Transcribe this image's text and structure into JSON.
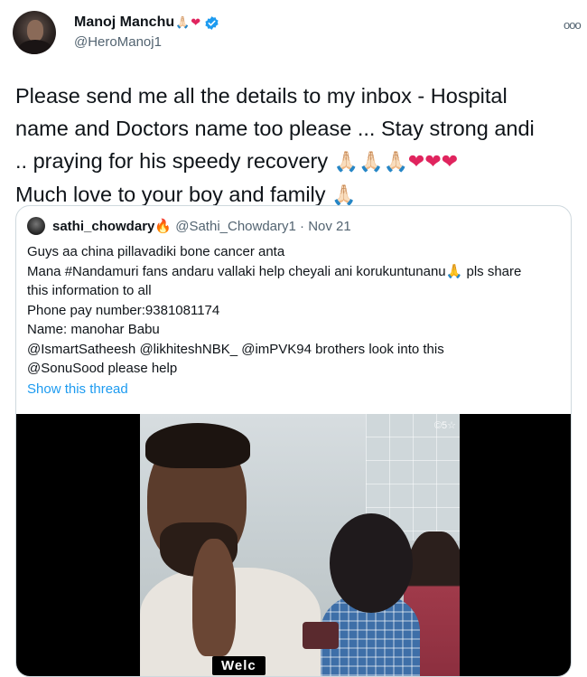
{
  "author": {
    "display_name": "Manoj Manchu",
    "name_emojis": [
      "🙏🏻",
      "❤"
    ],
    "handle": "@HeroManoj1"
  },
  "tweet": {
    "lines": [
      "Please send me all the details to my inbox - Hospital",
      "name and Doctors name too please ... Stay strong andi",
      ".. praying for his speedy recovery",
      "Much love to your boy and family"
    ],
    "line3_emojis": [
      "🙏🏻",
      "🙏🏻",
      "🙏🏻"
    ],
    "line3_hearts": [
      "❤",
      "❤",
      "❤"
    ],
    "line4_emoji": "🙏🏻"
  },
  "quoted": {
    "display_name": "sathi_chowdary",
    "name_emoji": "🔥",
    "handle": "@Sathi_Chowdary1",
    "separator": "·",
    "date": "Nov 21",
    "lines": [
      "Guys aa china pillavadiki bone cancer anta",
      "Mana #Nandamuri fans andaru vallaki help cheyali ani korukuntunanu",
      "this information to all",
      "Phone pay number:9381081174",
      "Name: manohar Babu",
      "@IsmartSatheesh @likhiteshNBK_ @imPVK94 brothers look into this",
      "@SonuSood please help"
    ],
    "line2_emoji": "🙏",
    "line2_tail": "pls share",
    "show_thread": "Show this thread",
    "video_watermark": "©5☆",
    "video_caption": "Welc"
  },
  "colors": {
    "verified": "#1d9bf0",
    "link": "#1d9bf0",
    "heart": "#e0245e",
    "muted": "#536471"
  }
}
